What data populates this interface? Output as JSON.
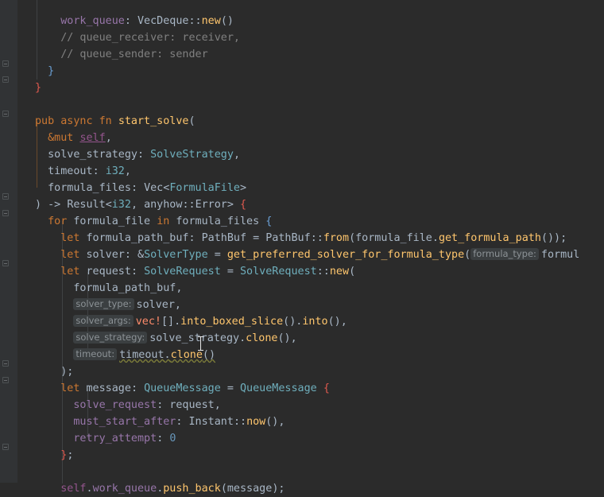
{
  "lines": [
    "        _             _  ",
    "    work_queue: VecDeque::new()",
    "    // queue_receiver: receiver,",
    "    // queue_sender: sender",
    "  }",
    "}",
    "",
    "pub async fn start_solve(",
    "  &mut self,",
    "  solve_strategy: SolveStrategy,",
    "  timeout: i32,",
    "  formula_files: Vec<FormulaFile>",
    ") -> Result<i32, anyhow::Error> {",
    "  for formula_file in formula_files {",
    "    let formula_path_buf: PathBuf = PathBuf::from(formula_file.get_formula_path());",
    "    let solver: &SolverType = get_preferred_solver_for_formula_type(formula_type: formul",
    "    let request: SolveRequest = SolveRequest::new(",
    "      formula_path_buf,",
    "      solver_type: solver,",
    "      solver_args: vec![].into_boxed_slice().into(),",
    "      solve_strategy: solve_strategy.clone(),",
    "      timeout: timeout.clone()",
    "    );",
    "    let message: QueueMessage = QueueMessage {",
    "      solve_request: request,",
    "      must_start_after: Instant::now(),",
    "      retry_attempt: 0",
    "    };",
    "",
    "    self.work_queue.push_back(message);"
  ],
  "code": {
    "work_queue": "work_queue",
    "vecdeque": "VecDeque",
    "new": "new",
    "comment_receiver": "// queue_receiver: receiver,",
    "comment_sender": "// queue_sender: sender",
    "pub": "pub",
    "async": "async",
    "fn_kw": "fn",
    "start_solve": "start_solve",
    "mut": "&mut",
    "self": "self",
    "solve_strategy": "solve_strategy",
    "SolveStrategy": "SolveStrategy",
    "timeout": "timeout",
    "i32": "i32",
    "formula_files": "formula_files",
    "Vec": "Vec",
    "FormulaFile": "FormulaFile",
    "Result": "Result",
    "anyhow": "anyhow",
    "Error": "Error",
    "for": "for",
    "formula_file": "formula_file",
    "in": "in",
    "let": "let",
    "formula_path_buf": "formula_path_buf",
    "PathBuf": "PathBuf",
    "from": "from",
    "get_formula_path": "get_formula_path",
    "solver": "solver",
    "SolverType": "SolverType",
    "get_preferred": "get_preferred_solver_for_formula_type",
    "formul": "formul",
    "request": "request",
    "SolveRequest": "SolveRequest",
    "vec": "vec!",
    "into_boxed_slice": "into_boxed_slice",
    "into": "into",
    "clone": "clone",
    "message": "message",
    "QueueMessage": "QueueMessage",
    "solve_request": "solve_request",
    "must_start_after": "must_start_after",
    "Instant": "Instant",
    "now": "now",
    "retry_attempt": "retry_attempt",
    "zero": "0",
    "work_queue2": "work_queue",
    "push_back": "push_back"
  },
  "hints": {
    "formula_type": "formula_type:",
    "solver_type": "solver_type:",
    "solver_args": "solver_args:",
    "solve_strategy": "solve_strategy:",
    "timeout": "timeout:"
  },
  "colors": {
    "background": "#2b2b2b",
    "keyword": "#cc7832",
    "function": "#ffc66d",
    "type": "#6fafbd",
    "field": "#9876aa",
    "comment": "#808080",
    "number": "#6897bb"
  }
}
